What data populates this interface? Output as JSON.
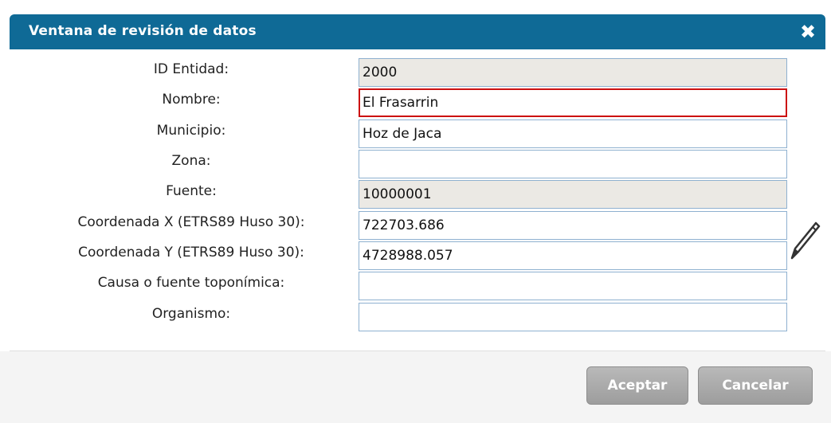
{
  "dialog": {
    "title": "Ventana de revisión de datos",
    "close_icon": "close-icon",
    "title_color": "#0f6a96"
  },
  "fields": [
    {
      "label": "ID Entidad:",
      "value": "2000",
      "readonly": true
    },
    {
      "label": "Nombre:",
      "value": "El Frasarrin",
      "focused": true
    },
    {
      "label": "Municipio:",
      "value": "Hoz de Jaca"
    },
    {
      "label": "Zona:",
      "value": ""
    },
    {
      "label": "Fuente:",
      "value": "10000001",
      "readonly": true
    },
    {
      "label": "Coordenada X (ETRS89 Huso 30):",
      "value": "722703.686"
    },
    {
      "label": "Coordenada Y (ETRS89 Huso 30):",
      "value": "4728988.057"
    },
    {
      "label": "Causa o fuente toponímica:",
      "value": ""
    },
    {
      "label": "Organismo:",
      "value": ""
    }
  ],
  "edit_icon": "pencil-icon",
  "buttons": {
    "accept": "Aceptar",
    "cancel": "Cancelar"
  }
}
